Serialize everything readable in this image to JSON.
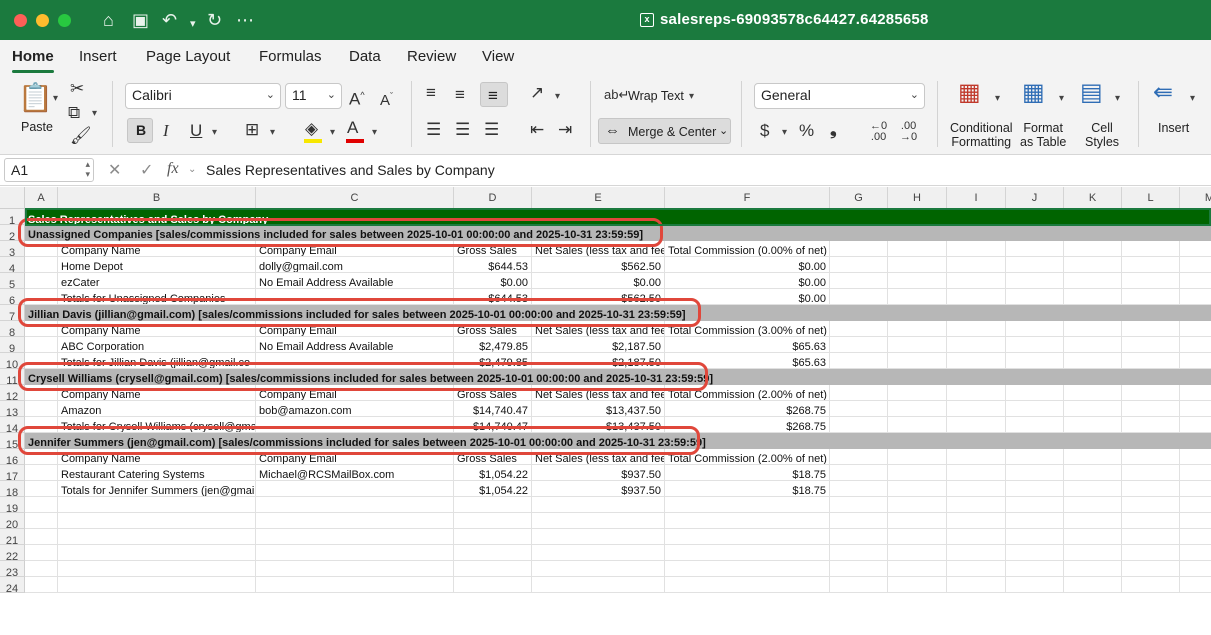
{
  "app": {
    "doc_title": "salesreps-69093578c64427.64285658",
    "doc_icon": "excel-file-icon"
  },
  "tabs": [
    "Home",
    "Insert",
    "Page Layout",
    "Formulas",
    "Data",
    "Review",
    "View"
  ],
  "ribbon": {
    "paste": "Paste",
    "font_name": "Calibri",
    "font_size": "11",
    "bold": "B",
    "italic": "I",
    "underline": "U",
    "wrap_text": "Wrap Text",
    "merge_center": "Merge & Center",
    "number_format": "General",
    "currency": "$",
    "percent": "%",
    "comma": "❟",
    "cond_format": [
      "Conditional",
      "Formatting"
    ],
    "format_table": [
      "Format",
      "as Table"
    ],
    "cell_styles": [
      "Cell",
      "Styles"
    ],
    "insert": "Insert",
    "font_grow": "A",
    "font_shrink": "A"
  },
  "formula_bar": {
    "cell_ref": "A1",
    "fx": "fx",
    "content": "Sales Representatives and Sales by Company"
  },
  "columns": [
    "A",
    "B",
    "C",
    "D",
    "E",
    "F",
    "G",
    "H",
    "I",
    "J",
    "K",
    "L",
    "M"
  ],
  "rows": [
    "1",
    "2",
    "3",
    "4",
    "5",
    "6",
    "7",
    "8",
    "9",
    "10",
    "11",
    "12",
    "13",
    "14",
    "15",
    "16",
    "17",
    "18",
    "19",
    "20",
    "21",
    "22",
    "23",
    "24"
  ],
  "sheet": {
    "title": "Sales Representatives and Sales by Company",
    "headers": {
      "company": "Company Name",
      "email": "Company Email",
      "gross": "Gross Sales",
      "net": "Net Sales (less tax and fees)"
    },
    "groups": [
      {
        "band": "Unassigned Companies [sales/commissions included for sales between 2025-10-01 00:00:00 and 2025-10-31 23:59:59]",
        "commission_header": "Total Commission (0.00% of net)",
        "rows": [
          {
            "company": "Home Depot",
            "email": "dolly@gmail.com",
            "gross": "$644.53",
            "net": "$562.50",
            "commission": "$0.00"
          },
          {
            "company": "ezCater",
            "email": "No Email Address Available",
            "gross": "$0.00",
            "net": "$0.00",
            "commission": "$0.00"
          }
        ],
        "totals": {
          "label": "Totals for Unassigned Companies",
          "gross": "$644.53",
          "net": "$562.50",
          "commission": "$0.00"
        }
      },
      {
        "band": "Jillian Davis (jillian@gmail.com) [sales/commissions included for sales between 2025-10-01 00:00:00 and 2025-10-31 23:59:59]",
        "commission_header": "Total Commission (3.00% of net)",
        "rows": [
          {
            "company": "ABC Corporation",
            "email": "No Email Address Available",
            "gross": "$2,479.85",
            "net": "$2,187.50",
            "commission": "$65.63"
          }
        ],
        "totals": {
          "label": "Totals for Jillian Davis (jillian@gmail.co",
          "gross": "$2,479.85",
          "net": "$2,187.50",
          "commission": "$65.63"
        }
      },
      {
        "band": "Crysell Williams (crysell@gmail.com) [sales/commissions included for sales between 2025-10-01 00:00:00 and 2025-10-31 23:59:59]",
        "commission_header": "Total Commission (2.00% of net)",
        "rows": [
          {
            "company": "Amazon",
            "email": "bob@amazon.com",
            "gross": "$14,740.47",
            "net": "$13,437.50",
            "commission": "$268.75"
          }
        ],
        "totals": {
          "label": "Totals for Crysell Williams (crysell@gma",
          "gross": "$14,740.47",
          "net": "$13,437.50",
          "commission": "$268.75"
        }
      },
      {
        "band": "Jennifer Summers (jen@gmail.com) [sales/commissions included for sales between 2025-10-01 00:00:00 and 2025-10-31 23:59:59]",
        "commission_header": "Total Commission (2.00% of net)",
        "rows": [
          {
            "company": "Restaurant Catering Systems",
            "email": "Michael@RCSMailBox.com",
            "gross": "$1,054.22",
            "net": "$937.50",
            "commission": "$18.75"
          }
        ],
        "totals": {
          "label": "Totals for Jennifer Summers (jen@gmail",
          "gross": "$1,054.22",
          "net": "$937.50",
          "commission": "$18.75"
        }
      }
    ]
  },
  "colors": {
    "title_bar": "#1b7a3e",
    "title_row_fill": "#006400",
    "band_fill": "#b7b7b7",
    "annotation": "#e0473b"
  }
}
